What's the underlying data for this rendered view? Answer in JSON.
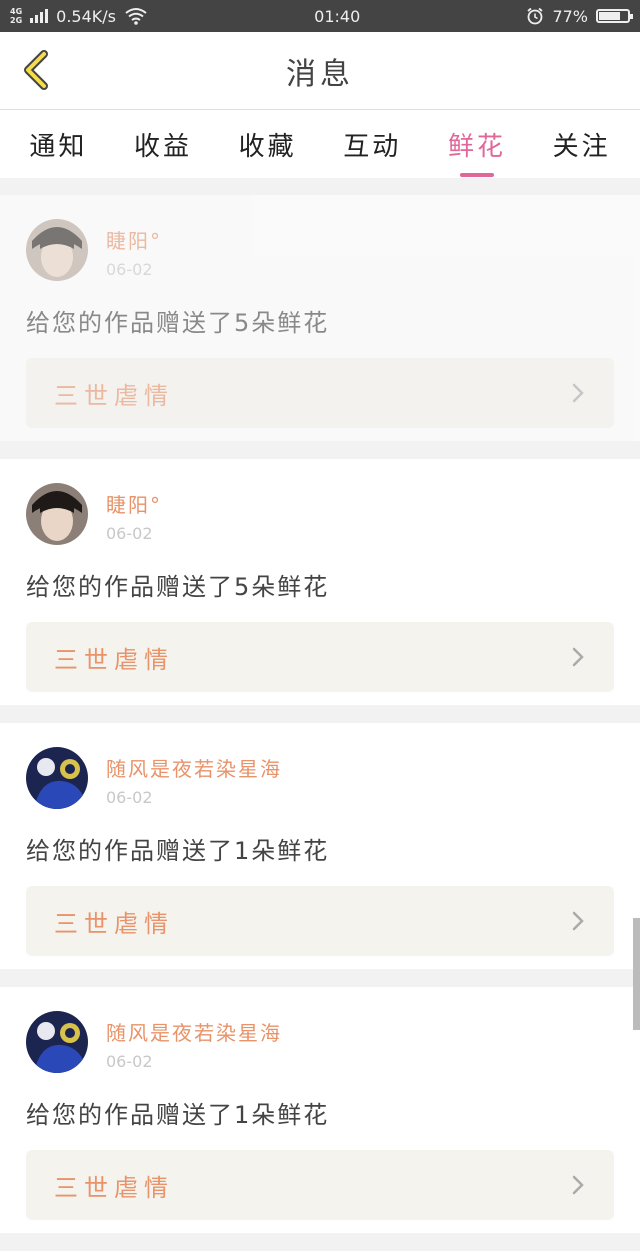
{
  "status_bar": {
    "network_top": "4G",
    "network_bottom": "2G",
    "speed": "0.54K/s",
    "time": "01:40",
    "battery": "77%",
    "battery_level": 0.77
  },
  "header": {
    "title": "消息"
  },
  "tabs": [
    {
      "label": "通知",
      "active": false
    },
    {
      "label": "收益",
      "active": false
    },
    {
      "label": "收藏",
      "active": false
    },
    {
      "label": "互动",
      "active": false
    },
    {
      "label": "鲜花",
      "active": true
    },
    {
      "label": "关注",
      "active": false
    }
  ],
  "messages": [
    {
      "username": "睫阳°",
      "date": "06-02",
      "text": "给您的作品赠送了5朵鲜花",
      "work": "三世虐情"
    },
    {
      "username": "睫阳°",
      "date": "06-02",
      "text": "给您的作品赠送了5朵鲜花",
      "work": "三世虐情"
    },
    {
      "username": "随风是夜若染星海",
      "date": "06-02",
      "text": "给您的作品赠送了1朵鲜花",
      "work": "三世虐情"
    },
    {
      "username": "随风是夜若染星海",
      "date": "06-02",
      "text": "给您的作品赠送了1朵鲜花",
      "work": "三世虐情"
    }
  ],
  "colors": {
    "accent": "#e0679a",
    "username": "#e8936a",
    "work_bg": "#f4f3ee"
  }
}
